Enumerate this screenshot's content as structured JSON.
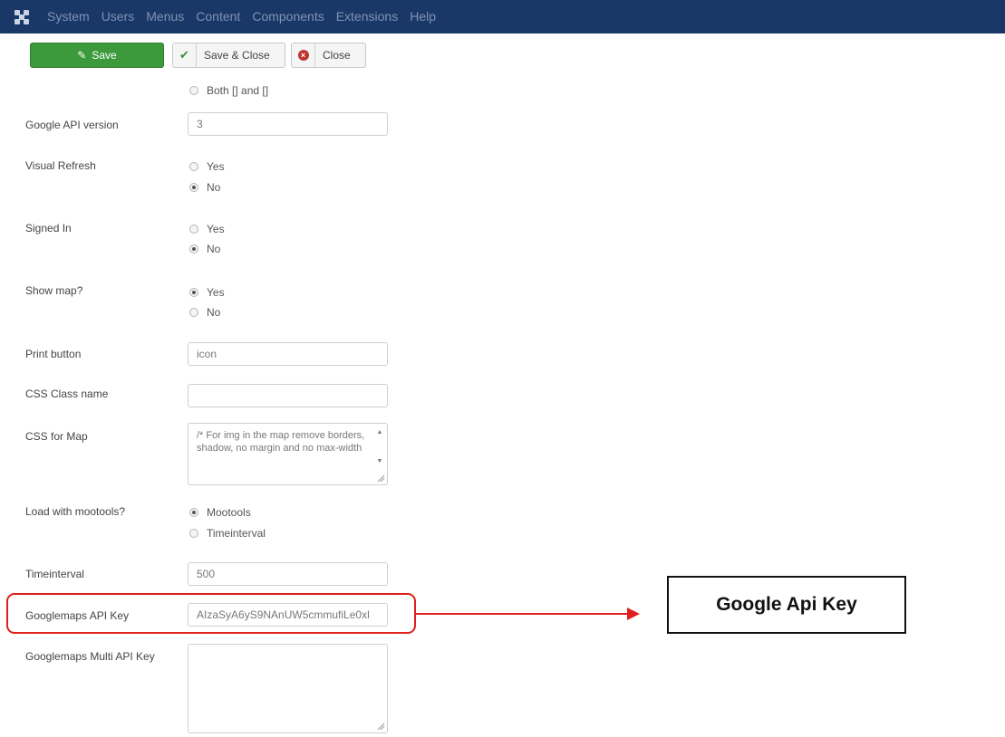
{
  "topbar": {
    "menu": [
      "System",
      "Users",
      "Menus",
      "Content",
      "Components",
      "Extensions",
      "Help"
    ]
  },
  "toolbar": {
    "save_label": "Save",
    "save_close_label": "Save & Close",
    "close_label": "Close"
  },
  "form": {
    "top_option_label": "Both [] and []",
    "google_api_version": {
      "label": "Google API version",
      "value": "3"
    },
    "visual_refresh": {
      "label": "Visual Refresh",
      "options": [
        "Yes",
        "No"
      ],
      "selected": "No"
    },
    "signed_in": {
      "label": "Signed In",
      "options": [
        "Yes",
        "No"
      ],
      "selected": "No"
    },
    "show_map": {
      "label": "Show map?",
      "options": [
        "Yes",
        "No"
      ],
      "selected": "Yes"
    },
    "print_button": {
      "label": "Print button",
      "value": "icon"
    },
    "css_class_name": {
      "label": "CSS Class name",
      "value": ""
    },
    "css_for_map": {
      "label": "CSS for Map",
      "value": "/* For img in the map remove borders, shadow, no margin and no max-width"
    },
    "load_with_mootools": {
      "label": "Load with mootools?",
      "options": [
        "Mootools",
        "Timeinterval"
      ],
      "selected": "Mootools"
    },
    "timeinterval": {
      "label": "Timeinterval",
      "value": "500"
    },
    "googlemaps_api_key": {
      "label": "Googlemaps API Key",
      "value": "AIzaSyA6yS9NAnUW5cmmufiLe0xl"
    },
    "googlemaps_multi_api_key": {
      "label": "Googlemaps Multi API Key",
      "value": ""
    }
  },
  "annotation": {
    "callout_text": "Google Api Key",
    "color": "#e0201c"
  }
}
